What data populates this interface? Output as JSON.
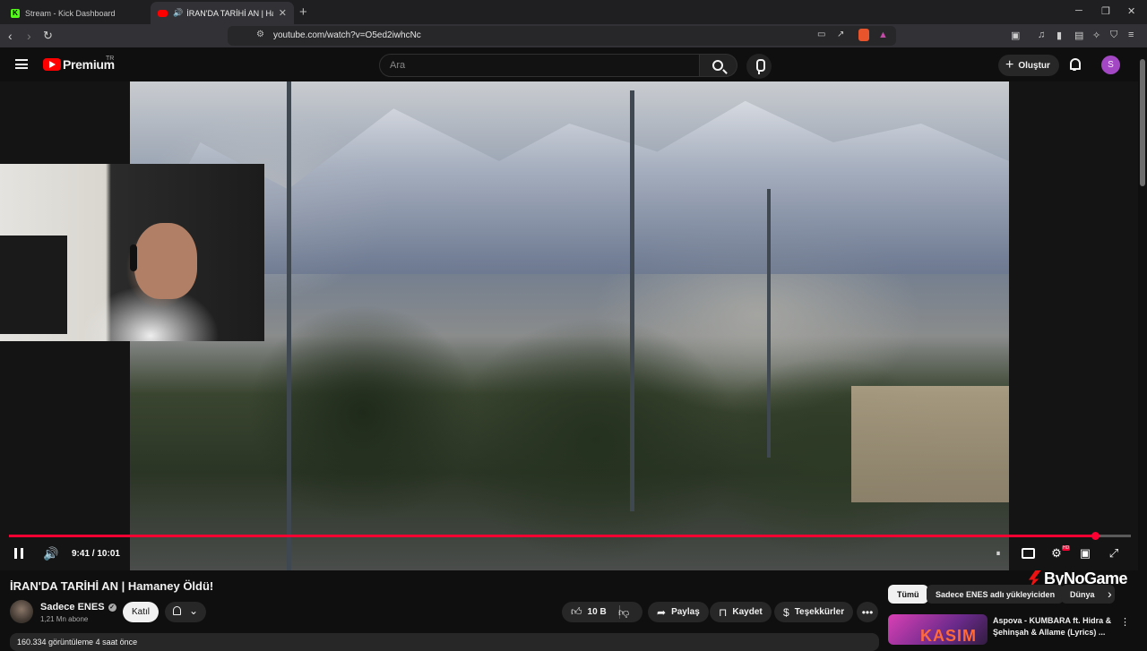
{
  "browser": {
    "tabs": [
      {
        "title": "Stream - Kick Dashboard",
        "active": false
      },
      {
        "title": "İRAN'DA TARİHİ AN | Hamaney Öldü!",
        "active": true
      }
    ],
    "url": "youtube.com/watch?v=O5ed2iwhcNc"
  },
  "youtube": {
    "brand": "Premium",
    "region": "TR",
    "search_placeholder": "Ara",
    "create_label": "Oluştur",
    "avatar_letter": "S"
  },
  "player": {
    "time_current": "9:41",
    "time_total": "10:01",
    "progress": 0.968
  },
  "watermark": "ByNoGame",
  "video": {
    "title": "İRAN'DA TARİHİ AN | Hamaney Öldü!",
    "channel": "Sadece ENES",
    "subscribers": "1,21 Mn abone",
    "join_label": "Katıl",
    "likes": "10 B",
    "share_label": "Paylaş",
    "save_label": "Kaydet",
    "thanks_label": "Teşekkürler",
    "description_preview": "160.334 görüntüleme  4 saat önce"
  },
  "chips": [
    "Tümü",
    "Sadece ENES adlı yükleyiciden",
    "Dünya"
  ],
  "recommendation": {
    "title": "Aspova - KUMBARA ft. Hidra & Şehinşah & Allame (Lyrics) ...",
    "thumb_text": "KASIM"
  },
  "colors": {
    "accent": "#ff0033",
    "avatar": "#a347c4",
    "youtube_red": "#ff0000"
  }
}
